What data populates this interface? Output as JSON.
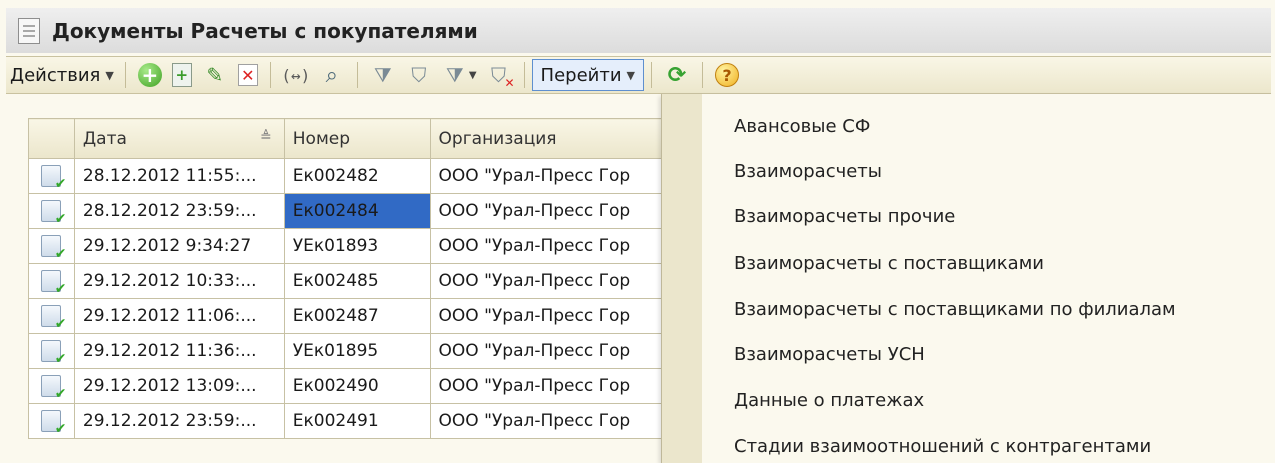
{
  "window": {
    "title": "Документы Расчеты с покупателями"
  },
  "toolbar": {
    "actions_label": "Действия",
    "goto_label": "Перейти",
    "icons": [
      "add-icon",
      "copy-icon",
      "edit-icon",
      "delete-icon",
      "range-icon",
      "search-icon",
      "filter-settings-icon",
      "filter-icon",
      "filter-history-icon",
      "filter-off-icon",
      "refresh-icon",
      "help-icon"
    ]
  },
  "table": {
    "columns": [
      "",
      "Дата",
      "Номер",
      "Организация"
    ],
    "rows": [
      {
        "date": "28.12.2012 11:55:...",
        "number": "Ек002482",
        "org": "ООО \"Урал-Пресс Гор"
      },
      {
        "date": "28.12.2012 23:59:...",
        "number": "Ек002484",
        "org": "ООО \"Урал-Пресс Гор"
      },
      {
        "date": "29.12.2012 9:34:27",
        "number": "УЕк01893",
        "org": "ООО \"Урал-Пресс Гор"
      },
      {
        "date": "29.12.2012 10:33:...",
        "number": "Ек002485",
        "org": "ООО \"Урал-Пресс Гор"
      },
      {
        "date": "29.12.2012 11:06:...",
        "number": "Ек002487",
        "org": "ООО \"Урал-Пресс Гор"
      },
      {
        "date": "29.12.2012 11:36:...",
        "number": "УЕк01895",
        "org": "ООО \"Урал-Пресс Гор"
      },
      {
        "date": "29.12.2012 13:09:...",
        "number": "Ек002490",
        "org": "ООО \"Урал-Пресс Гор"
      },
      {
        "date": "29.12.2012 23:59:...",
        "number": "Ек002491",
        "org": "ООО \"Урал-Пресс Гор"
      }
    ]
  },
  "goto_menu": {
    "items": [
      "Авансовые СФ",
      "Взаиморасчеты",
      "Взаиморасчеты прочие",
      "Взаиморасчеты с поставщиками",
      "Взаиморасчеты с поставщиками по филиалам",
      "Взаиморасчеты УСН",
      "Данные о платежах",
      "Стадии взаимоотношений с контрагентами"
    ]
  },
  "colors": {
    "selection": "#316ac5",
    "toolbar_bg": "#f3efda",
    "menu_highlight": "#e5eefb"
  }
}
